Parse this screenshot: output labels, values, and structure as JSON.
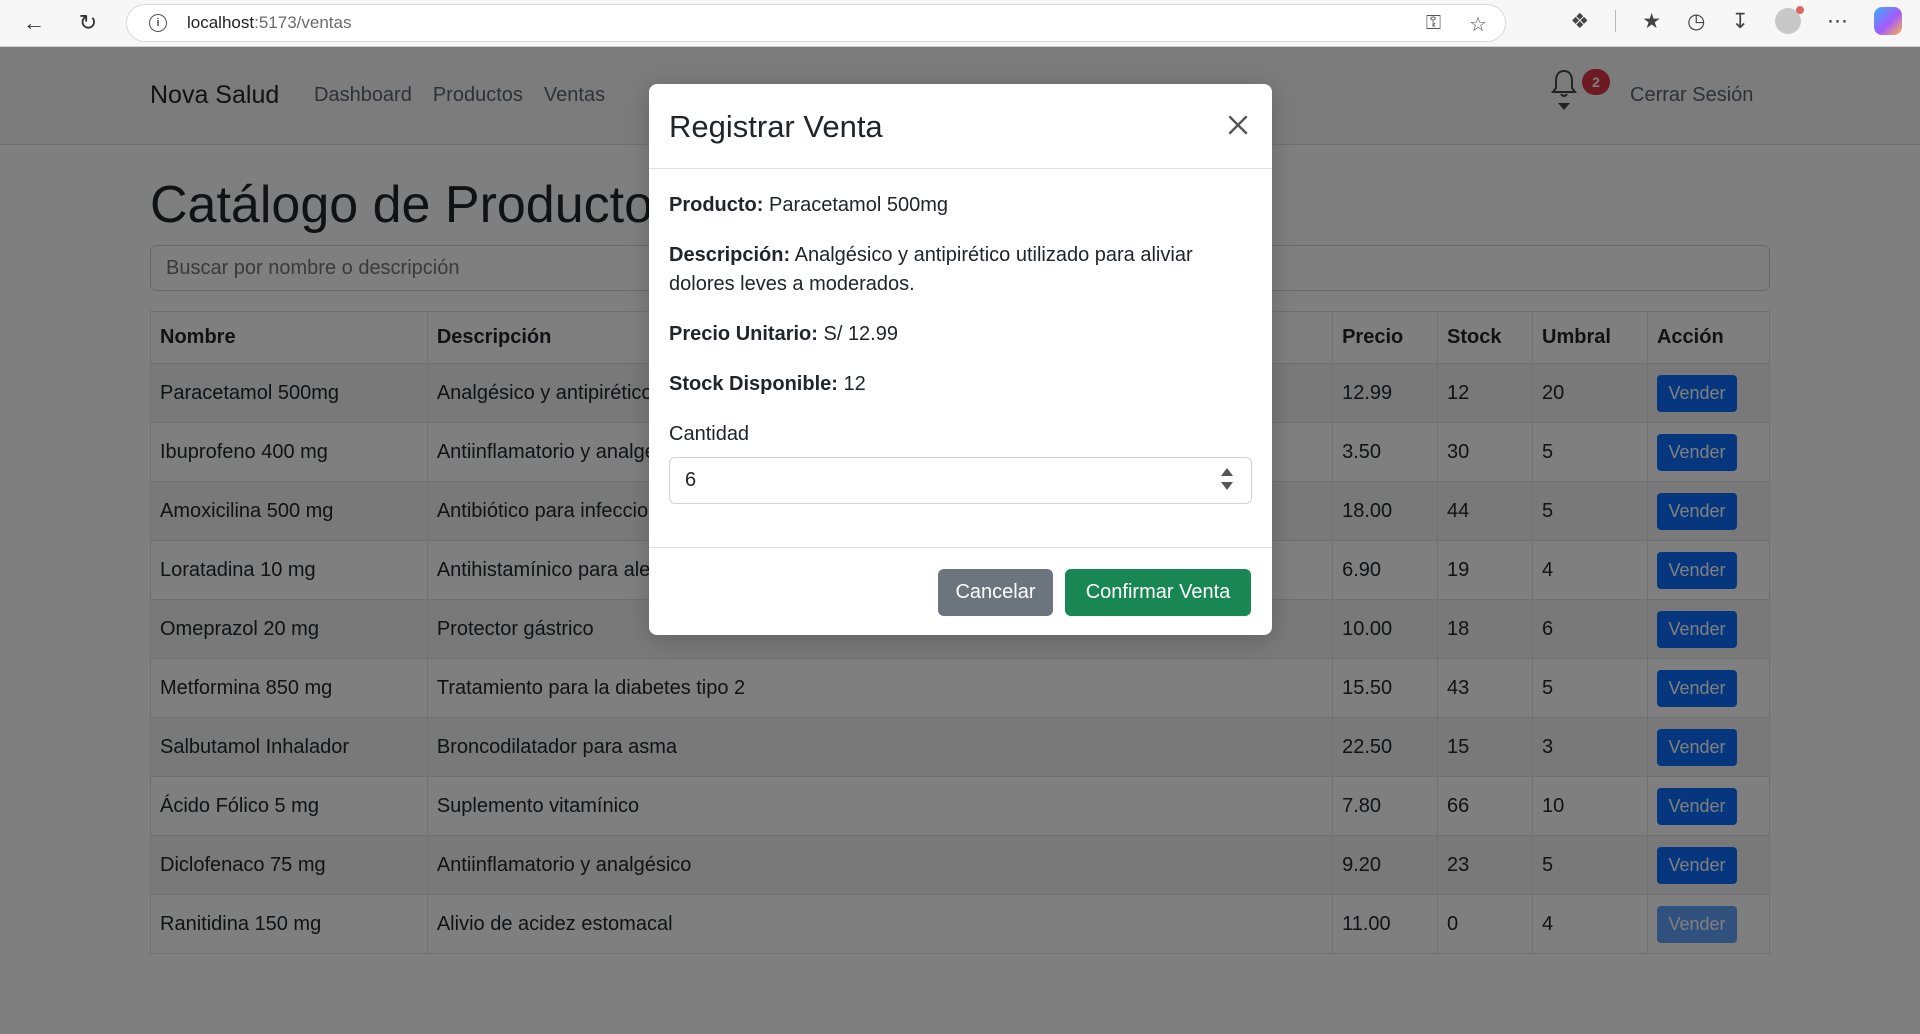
{
  "browser": {
    "url_host": "localhost",
    "url_path": ":5173/ventas"
  },
  "navbar": {
    "brand": "Nova Salud",
    "links": [
      "Dashboard",
      "Productos",
      "Ventas"
    ],
    "notification_count": "2",
    "logout_label": "Cerrar Sesión"
  },
  "main": {
    "title": "Catálogo de Productos",
    "search_placeholder": "Buscar por nombre o descripción",
    "columns": [
      "Nombre",
      "Descripción",
      "Precio",
      "Stock",
      "Umbral",
      "Acción"
    ],
    "sell_label": "Vender",
    "rows": [
      {
        "name": "Paracetamol 500mg",
        "desc": "Analgésico y antipirético utilizado para aliviar dolores leves a moderados.",
        "price": "12.99",
        "stock": "12",
        "umbral": "20",
        "disabled": false
      },
      {
        "name": "Ibuprofeno 400 mg",
        "desc": "Antiinflamatorio y analgésico",
        "price": "3.50",
        "stock": "30",
        "umbral": "5",
        "disabled": false
      },
      {
        "name": "Amoxicilina 500 mg",
        "desc": "Antibiótico para infecciones",
        "price": "18.00",
        "stock": "44",
        "umbral": "5",
        "disabled": false
      },
      {
        "name": "Loratadina 10 mg",
        "desc": "Antihistamínico para alergias",
        "price": "6.90",
        "stock": "19",
        "umbral": "4",
        "disabled": false
      },
      {
        "name": "Omeprazol 20 mg",
        "desc": "Protector gástrico",
        "price": "10.00",
        "stock": "18",
        "umbral": "6",
        "disabled": false
      },
      {
        "name": "Metformina 850 mg",
        "desc": "Tratamiento para la diabetes tipo 2",
        "price": "15.50",
        "stock": "43",
        "umbral": "5",
        "disabled": false
      },
      {
        "name": "Salbutamol Inhalador",
        "desc": "Broncodilatador para asma",
        "price": "22.50",
        "stock": "15",
        "umbral": "3",
        "disabled": false
      },
      {
        "name": "Ácido Fólico 5 mg",
        "desc": "Suplemento vitamínico",
        "price": "7.80",
        "stock": "66",
        "umbral": "10",
        "disabled": false
      },
      {
        "name": "Diclofenaco 75 mg",
        "desc": "Antiinflamatorio y analgésico",
        "price": "9.20",
        "stock": "23",
        "umbral": "5",
        "disabled": false
      },
      {
        "name": "Ranitidina 150 mg",
        "desc": "Alivio de acidez estomacal",
        "price": "11.00",
        "stock": "0",
        "umbral": "4",
        "disabled": true
      }
    ]
  },
  "modal": {
    "title": "Registrar Venta",
    "product_label": "Producto:",
    "product_value": "Paracetamol 500mg",
    "description_label": "Descripción:",
    "description_value": "Analgésico y antipirético utilizado para aliviar dolores leves a moderados.",
    "price_label": "Precio Unitario:",
    "price_value": "S/ 12.99",
    "stock_label": "Stock Disponible:",
    "stock_value": "12",
    "quantity_label": "Cantidad",
    "quantity_value": "6",
    "cancel_label": "Cancelar",
    "confirm_label": "Confirmar Venta"
  },
  "colors": {
    "primary": "#0d6efd",
    "success": "#198754",
    "secondary": "#6c757d",
    "danger": "#dc3545"
  }
}
